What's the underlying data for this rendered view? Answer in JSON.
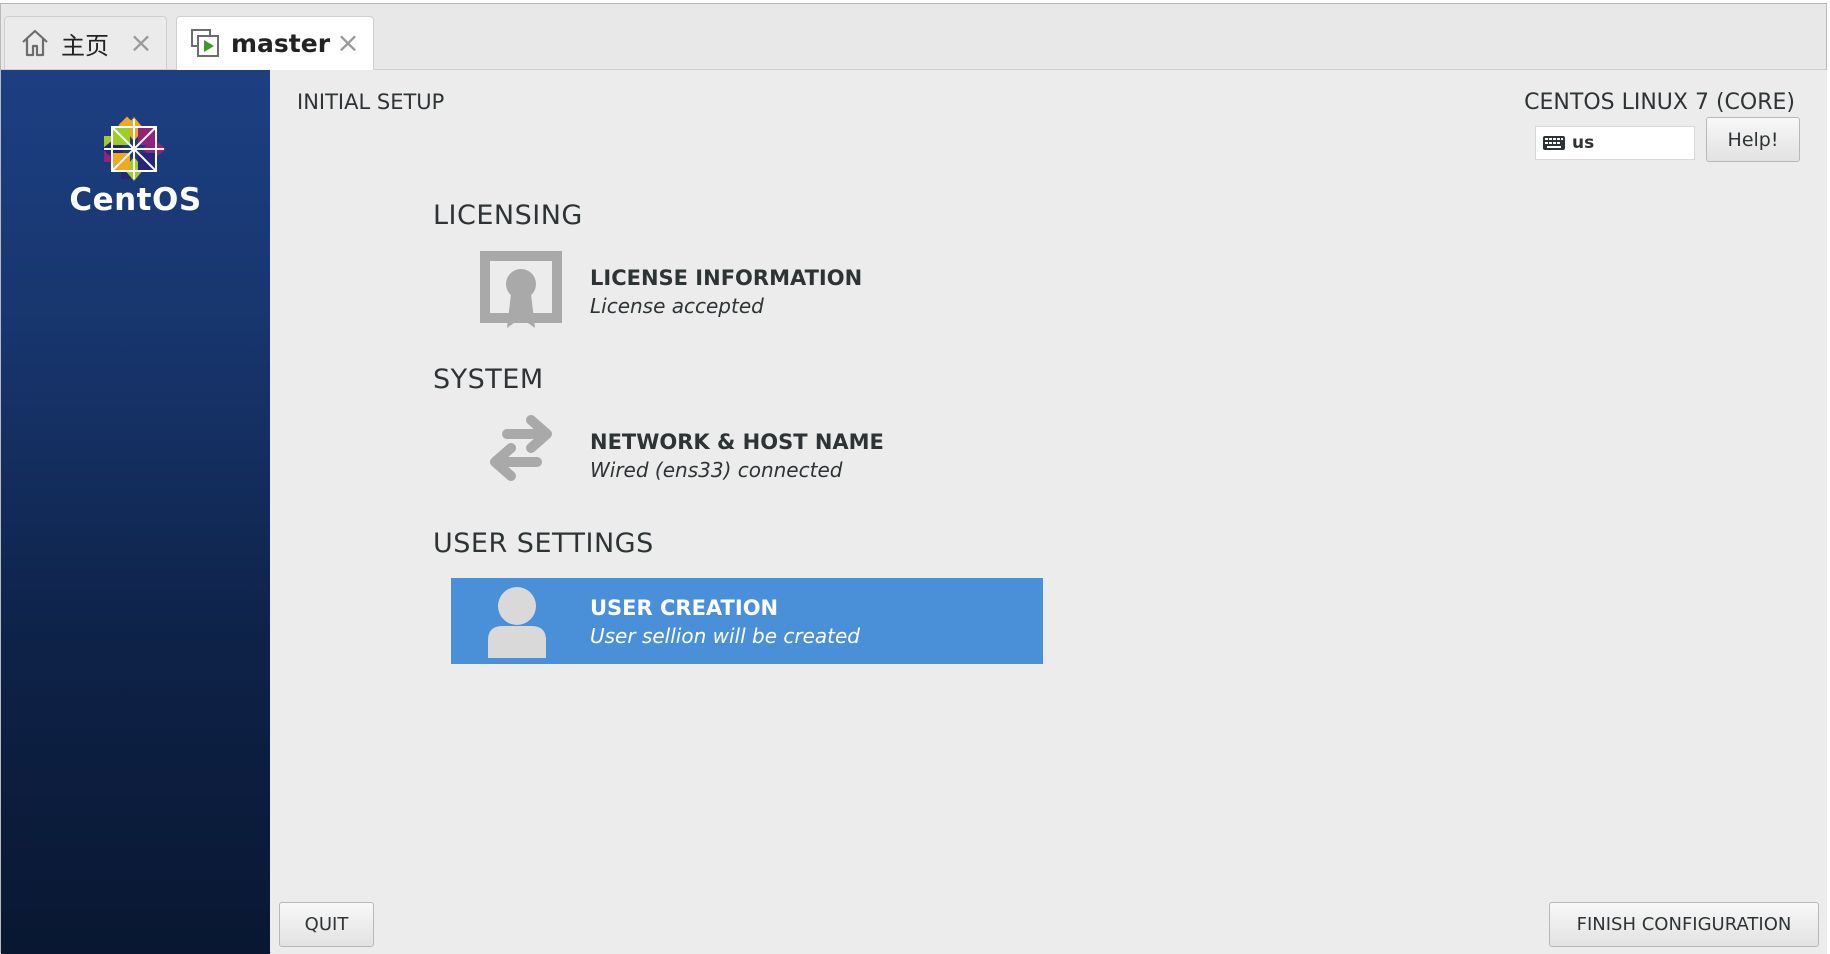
{
  "tabs": [
    {
      "label": "主页",
      "icon": "home-icon"
    },
    {
      "label": "master",
      "icon": "vm-play-icon"
    }
  ],
  "brand": {
    "name": "CentOS"
  },
  "header": {
    "title": "INITIAL SETUP",
    "product": "CENTOS LINUX 7 (CORE)",
    "keyboard_layout": "us",
    "help_label": "Help!"
  },
  "sections": [
    {
      "title": "LICENSING",
      "spokes": [
        {
          "title": "LICENSE INFORMATION",
          "status": "License accepted",
          "icon": "license-icon"
        }
      ]
    },
    {
      "title": "SYSTEM",
      "spokes": [
        {
          "title": "NETWORK & HOST NAME",
          "status": "Wired (ens33) connected",
          "icon": "network-arrows-icon"
        }
      ]
    },
    {
      "title": "USER SETTINGS",
      "spokes": [
        {
          "title": "USER CREATION",
          "status": "User sellion will be created",
          "icon": "user-icon",
          "selected": true
        }
      ]
    }
  ],
  "footer": {
    "quit_label": "QUIT",
    "finish_label": "FINISH CONFIGURATION"
  },
  "colors": {
    "selected": "#4a90d9",
    "sidebar": "#17356d",
    "background": "#ececec"
  }
}
